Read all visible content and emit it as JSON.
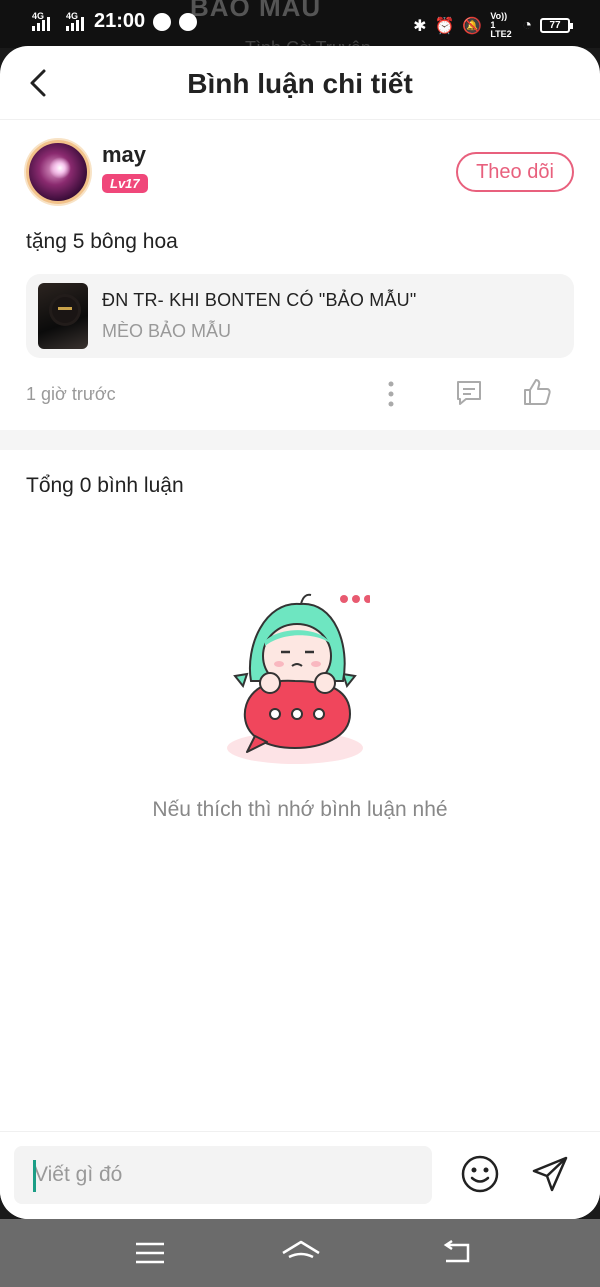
{
  "status_bar": {
    "time": "21:00",
    "sim1": "4G",
    "sim2": "4G",
    "lte_label": "Vo)) 1 LTE2",
    "battery": "77",
    "background_title": "BẢO MẪU",
    "background_sub": "Tình Cờ Truyện"
  },
  "header": {
    "title": "Bình luận chi tiết"
  },
  "post": {
    "username": "may",
    "level": "Lv17",
    "follow_label": "Theo dõi",
    "content": "tặng 5 bông hoa",
    "story": {
      "title": "ĐN TR- KHI BONTEN CÓ \"BẢO MẪU\"",
      "author": "MÈO BẢO MẪU"
    },
    "time": "1 giờ trước"
  },
  "comments": {
    "total_label": "Tổng 0 bình luận",
    "empty_text": "Nếu thích thì nhớ bình luận nhé"
  },
  "input": {
    "placeholder": "Viết gì đó"
  },
  "colors": {
    "accent": "#e8607d",
    "level_badge": "#f0477a",
    "caret": "#1b9e86"
  },
  "icons": {
    "back": "back-arrow-icon",
    "more": "more-vertical-icon",
    "comment": "comment-icon",
    "like": "thumbs-up-icon",
    "emoji": "emoji-icon",
    "send": "send-icon",
    "nav_menu": "menu-icon",
    "nav_home": "home-icon",
    "nav_back": "back-icon"
  }
}
